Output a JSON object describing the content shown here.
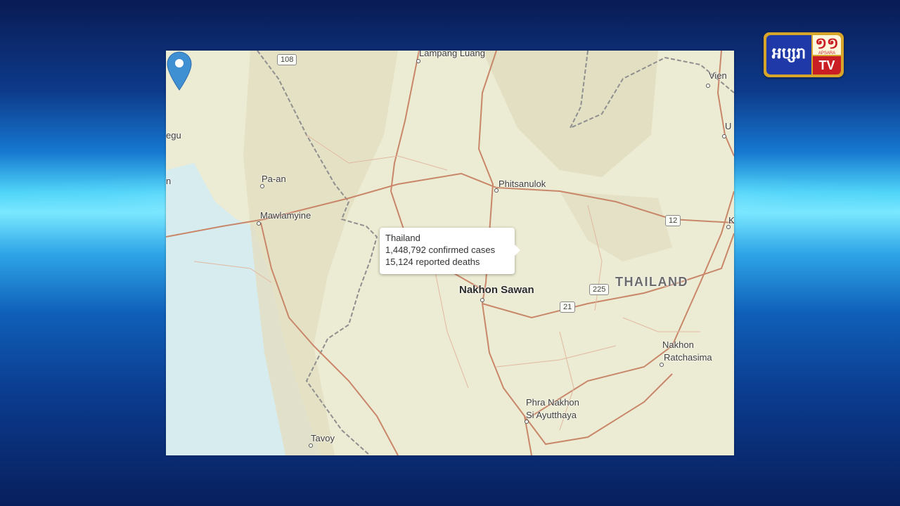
{
  "channel_logo": {
    "khmer_name": "អប្សរា",
    "number": "១១",
    "sub": "APSARA",
    "tv": "TV"
  },
  "map": {
    "places": {
      "lampang_luang": "Lampang Luang",
      "vientiane": "Vien",
      "udon": "U",
      "khon": "K",
      "pegu": "egu",
      "pegu_n": "n",
      "pa_an": "Pa-an",
      "mawlamyine": "Mawlamyine",
      "phitsanulok": "Phitsanulok",
      "nakhon_sawan": "Nakhon Sawan",
      "thailand": "THAILAND",
      "nakhon_ratchasima_1": "Nakhon",
      "nakhon_ratchasima_2": "Ratchasima",
      "ayutthaya_1": "Phra Nakhon",
      "ayutthaya_2": "Si Ayutthaya",
      "tavoy": "Tavoy"
    },
    "road_shields": {
      "r108": "108",
      "r12": "12",
      "r225": "225",
      "r21": "21"
    },
    "popup": {
      "country": "Thailand",
      "confirmed": "1,448,792 confirmed cases",
      "deaths": "15,124 reported deaths"
    },
    "colors": {
      "land": "#ecebd3",
      "water": "#d7ecef",
      "road": "#c9876a",
      "border": "#8f8f8f",
      "pin": "#3f8fd3"
    }
  }
}
